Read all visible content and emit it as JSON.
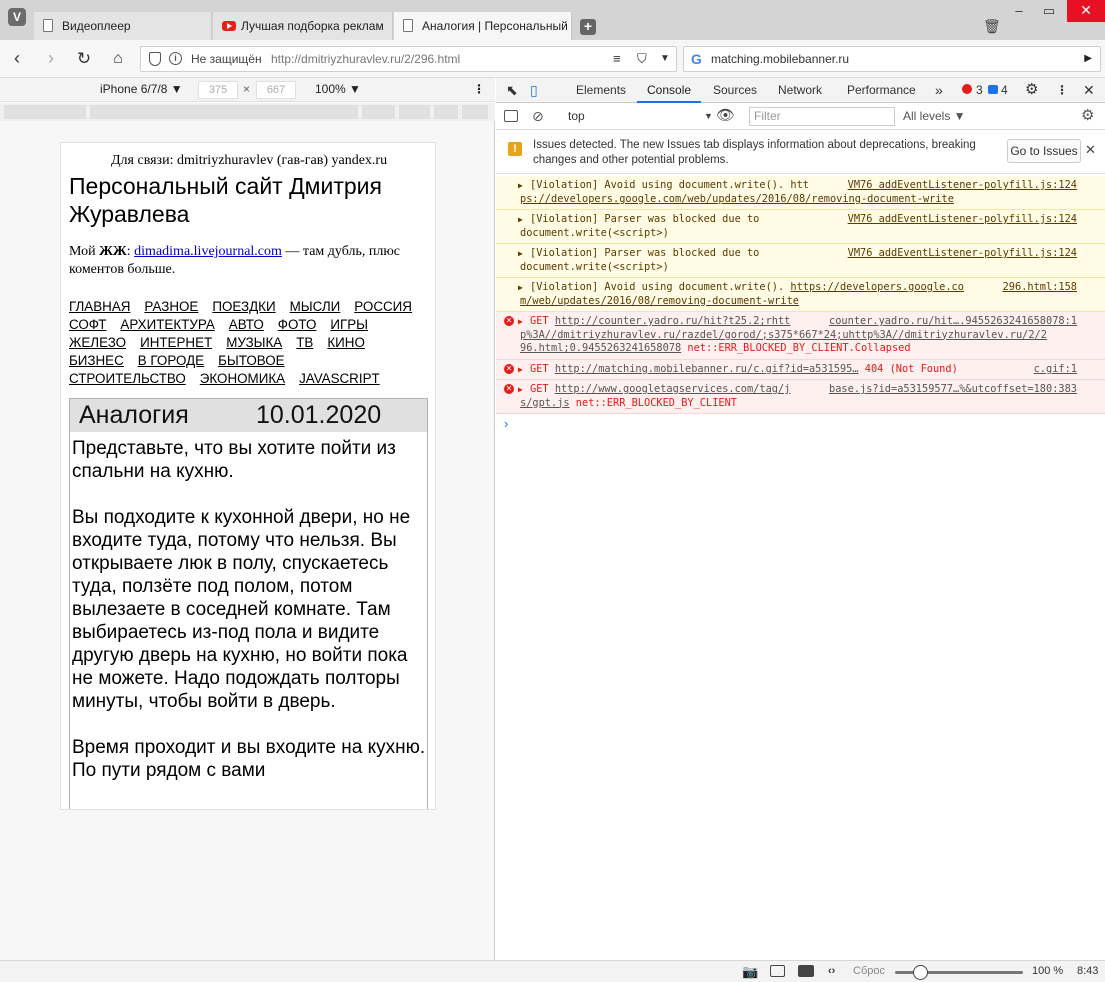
{
  "tabs": [
    {
      "title": "Видеоплеер",
      "icon": "page-icon"
    },
    {
      "title": "Лучшая подборка реклам",
      "icon": "youtube-icon"
    },
    {
      "title": "Аналогия | Персональный",
      "icon": "page-icon"
    }
  ],
  "address": {
    "security": "Не защищён",
    "url": "http://dmitriyzhuravlev.ru/2/296.html",
    "search": "matching.mobilebanner.ru"
  },
  "device": {
    "name": "iPhone 6/7/8 ▼",
    "width": "375",
    "height": "667",
    "times": "×",
    "zoom": "100% ▼"
  },
  "page": {
    "contact": "Для связи: dmitriyzhuravlev (гав-гав) yandex.ru",
    "title": "Персональный сайт Дмитрия Журавлева",
    "lj_prefix": "Мой ",
    "lj_bold": "ЖЖ",
    "lj_colon": ": ",
    "lj_link": "dimadima.livejournal.com",
    "lj_suffix": " — там дубль, плюс коментов больше.",
    "nav": [
      "ГЛАВНАЯ",
      "РАЗНОЕ",
      "ПОЕЗДКИ",
      "МЫСЛИ",
      "РОССИЯ",
      "СОФТ",
      "АРХИТЕКТУРА",
      "АВТО",
      "ФОТО",
      "ИГРЫ",
      "ЖЕЛЕЗО",
      "ИНТЕРНЕТ",
      "МУЗЫКА",
      "ТВ",
      "КИНО",
      "БИЗНЕС",
      "В ГОРОДЕ",
      "БЫТОВОЕ",
      "СТРОИТЕЛЬСТВО",
      "ЭКОНОМИКА",
      "JAVASCRIPT"
    ],
    "article_title": "Аналогия",
    "article_date": "10.01.2020",
    "paragraphs": [
      "Представьте, что вы хотите пойти из спальни на кухню.",
      "Вы подходите к кухонной двери, но не входите туда, потому что нельзя. Вы открываете люк в полу, спускаетесь туда, ползёте под полом, потом вылезаете в соседней комнате. Там выбираетесь из-под пола и видите другую дверь на кухню, но войти пока не можете. Надо подождать полторы минуты, чтобы войти в дверь.",
      "Время проходит и вы входите на кухню. По пути рядом с вами"
    ]
  },
  "devtools": {
    "tabs": [
      "Elements",
      "Console",
      "Sources",
      "Network",
      "Performance"
    ],
    "more": "»",
    "errors": "3",
    "messages": "4",
    "context": "top",
    "filter_placeholder": "Filter",
    "levels": "All levels ▼",
    "issues_text": "Issues detected. The new Issues tab displays information about deprecations, breaking changes and other potential problems.",
    "go_to_issues": "Go to Issues",
    "console": [
      {
        "level": "warn",
        "text": "[Violation] Avoid using document.write(). htt",
        "link": "ps://developers.google.com/web/updates/2016/08/removing-document-write",
        "src": "VM76 addEventListener-polyfill.js:124"
      },
      {
        "level": "warn",
        "text": "[Violation] Parser was blocked due to",
        "text2": "document.write(<script>)",
        "src": "VM76 addEventListener-polyfill.js:124"
      },
      {
        "level": "warn",
        "text": "[Violation] Parser was blocked due to",
        "text2": "document.write(<script>)",
        "src": "VM76 addEventListener-polyfill.js:124"
      },
      {
        "level": "warn",
        "text": "[Violation] Avoid using document.write(). ",
        "url": "https://developers.google.co",
        "link": "m/web/updates/2016/08/removing-document-write",
        "src": "296.html:158"
      },
      {
        "level": "error",
        "method": "GET ",
        "url": "http://counter.yadro.ru/hit?t25.2;rhtt",
        "src": "counter.yadro.ru/hit….9455263241658078:1",
        "line2": "p%3A//dmitriyzhuravlev.ru/razdel/gorod/;s375*667*24;uhttp%3A//dmitriyzhuravlev.ru/2/2",
        "line3": "96.html;0.9455263241658078",
        "status": " net::ERR_BLOCKED_BY_CLIENT.Collapsed"
      },
      {
        "level": "error",
        "method": "GET ",
        "url": "http://matching.mobilebanner.ru/c.gif?id=a531595…",
        "status": " 404 (Not Found)",
        "src": "c.gif:1"
      },
      {
        "level": "error",
        "method": "GET ",
        "url": "http://www.googletagservices.com/tag/j",
        "src": "base.js?id=a53159577…%&utcoffset=180:383",
        "line2": "s/gpt.js",
        "status": " net::ERR_BLOCKED_BY_CLIENT"
      }
    ]
  },
  "status": {
    "reset": "Сброс",
    "zoom": "100 %",
    "time": "8:43"
  },
  "colors": {
    "accent": "#1a73e8",
    "error": "#e41b17",
    "warning_bg": "#fffbe5",
    "error_bg": "#fff0f0"
  }
}
